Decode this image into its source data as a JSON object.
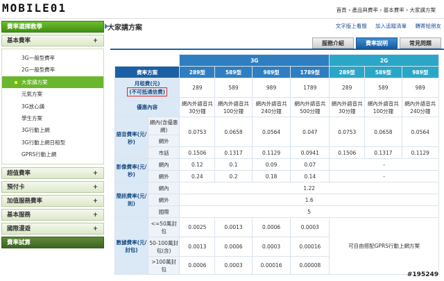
{
  "logo": "MOBILE01",
  "breadcrumb": "首頁 › 產品與費率 › 基本費率 › 大家講方案",
  "sidebar": {
    "top": "費率選擇教學",
    "basic": "基本費率",
    "subs": [
      "3G一般型費率",
      "2G一般型費率",
      "大家講方案",
      "元氣方案",
      "3G放心講",
      "學生方案",
      "3G行動上網",
      "3G行動上網日租型",
      "GPRS行動上網"
    ],
    "others": [
      "超值費率",
      "預付卡",
      "加值服務費率",
      "基本服務",
      "國際漫遊"
    ],
    "calc": "費率試算"
  },
  "page": {
    "title": "大家講方案"
  },
  "tools": {
    "print": "文字版上看服",
    "print2": "加入追蹤清單",
    "forward": "轉寄給朋友"
  },
  "tabs": [
    "服務介紹",
    "費率說明",
    "常見問題"
  ],
  "table": {
    "g3": "3G",
    "g2": "2G",
    "plan_header": "費率方案",
    "plans": [
      "289型",
      "589型",
      "989型",
      "1789型",
      "289型",
      "589型",
      "989型"
    ],
    "monthly_label": "月租費(元)",
    "monthly_note": "(不可抵通信費)",
    "monthly": [
      "289",
      "589",
      "989",
      "1789",
      "289",
      "589",
      "989"
    ],
    "offer_label": "優惠內容",
    "offers": [
      "網內外語音共30分鐘",
      "網內外語音共100分鐘",
      "網內外語音共240分鐘",
      "網內外語音共500分鐘",
      "網內外語音共30分鐘",
      "網內外語音共100分鐘",
      "網內外語音共240分鐘"
    ],
    "voice_label": "語音費率(元/秒)",
    "voice_in_label": "網內(含優惠網)",
    "voice_in": [
      "0.0753",
      "0.0658",
      "0.0564",
      "0.047",
      "0.0753",
      "0.0658",
      "0.0564"
    ],
    "voice_out_label": "網外",
    "voice_out": [
      "",
      "",
      "",
      "",
      "",
      "",
      ""
    ],
    "voice_land_label": "市話",
    "voice_land": [
      "0.1506",
      "0.1317",
      "0.1129",
      "0.0941",
      "0.1506",
      "0.1317",
      "0.1129"
    ],
    "video_label": "影像費率(元/秒)",
    "video_in_label": "網內",
    "video_in": [
      "0.12",
      "0.1",
      "0.09",
      "0.07"
    ],
    "video_out_label": "網外",
    "video_out": [
      "0.24",
      "0.2",
      "0.18",
      "0.14"
    ],
    "video_2g": "-",
    "sms_label": "簡訊費率(元/則)",
    "sms_in_label": "網內",
    "sms_in": "1.22",
    "sms_out_label": "網外",
    "sms_out": "1.6",
    "sms_intl_label": "國際",
    "sms_intl": "5",
    "data_label": "數據費率(元/封包)",
    "data_rows": [
      {
        "label": "<=50萬封包",
        "v": [
          "0.0025",
          "0.0013",
          "0.0006",
          "0.0003"
        ]
      },
      {
        "label": "50-100萬封包(含)",
        "v": [
          "0.0013",
          "0.0006",
          "0.0003",
          "0.00016"
        ]
      },
      {
        "label": ">100萬封包",
        "v": [
          "0.0006",
          "0.0003",
          "0.00016",
          "0.00008"
        ]
      }
    ],
    "data_2g": "可自由搭配GPRS行動上網方案"
  },
  "watermark": "#195249"
}
